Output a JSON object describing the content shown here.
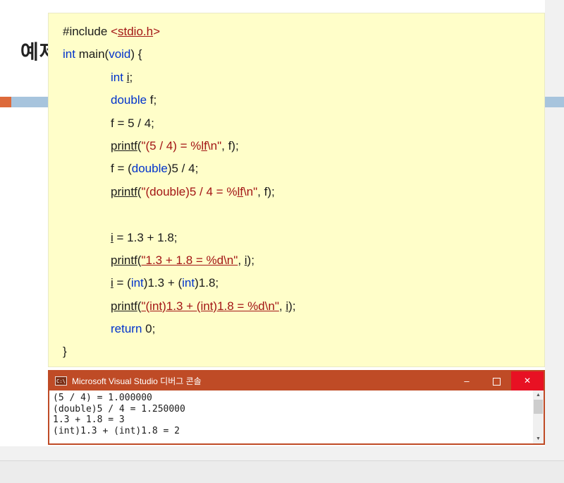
{
  "page": {
    "heading": "예제"
  },
  "colors": {
    "code_background": "#fffec9",
    "keyword_blue": "#0033cc",
    "string_maroon": "#a31515",
    "console_titlebar_orange": "#bf4b26",
    "close_button_red": "#e81123",
    "divider_blue": "#a7c4dd",
    "divider_orange": "#dd6a3b"
  },
  "code": {
    "lines": [
      {
        "ind": 0,
        "seg": [
          {
            "t": "#include ",
            "c": "p"
          },
          {
            "t": "<",
            "c": "s"
          },
          {
            "t": "stdio.h",
            "c": "s",
            "u": true
          },
          {
            "t": ">",
            "c": "s"
          }
        ]
      },
      {
        "ind": 0,
        "seg": [
          {
            "t": "int",
            "c": "k"
          },
          {
            "t": " main(",
            "c": "p"
          },
          {
            "t": "void",
            "c": "k"
          },
          {
            "t": ") {",
            "c": "p"
          }
        ]
      },
      {
        "ind": 1,
        "seg": [
          {
            "t": "int",
            "c": "k"
          },
          {
            "t": " ",
            "c": "p"
          },
          {
            "t": "i",
            "c": "p",
            "u": true
          },
          {
            "t": ";",
            "c": "p"
          }
        ]
      },
      {
        "ind": 1,
        "seg": [
          {
            "t": "double",
            "c": "k"
          },
          {
            "t": " f;",
            "c": "p"
          }
        ]
      },
      {
        "ind": 1,
        "seg": [
          {
            "t": "f = 5 / 4;",
            "c": "p"
          }
        ]
      },
      {
        "ind": 1,
        "seg": [
          {
            "t": "printf",
            "c": "p",
            "u": true
          },
          {
            "t": "(",
            "c": "p"
          },
          {
            "t": "\"(5 / 4) = %",
            "c": "s"
          },
          {
            "t": "lf",
            "c": "s",
            "u": true
          },
          {
            "t": "\\n\"",
            "c": "s"
          },
          {
            "t": ", f);",
            "c": "p"
          }
        ]
      },
      {
        "ind": 1,
        "seg": [
          {
            "t": "f = (",
            "c": "p"
          },
          {
            "t": "double",
            "c": "k"
          },
          {
            "t": ")5 / 4;",
            "c": "p"
          }
        ]
      },
      {
        "ind": 1,
        "seg": [
          {
            "t": "printf",
            "c": "p",
            "u": true
          },
          {
            "t": "(",
            "c": "p"
          },
          {
            "t": "\"(double)5 / 4 = %",
            "c": "s"
          },
          {
            "t": "lf",
            "c": "s",
            "u": true
          },
          {
            "t": "\\n\"",
            "c": "s"
          },
          {
            "t": ", f);",
            "c": "p"
          }
        ]
      },
      {
        "ind": 1,
        "seg": []
      },
      {
        "ind": 1,
        "seg": [
          {
            "t": "i",
            "c": "p",
            "u": true
          },
          {
            "t": " = 1.3 + 1.8;",
            "c": "p"
          }
        ]
      },
      {
        "ind": 1,
        "seg": [
          {
            "t": "printf",
            "c": "p",
            "u": true
          },
          {
            "t": "(",
            "c": "p"
          },
          {
            "t": "\"1.3 + 1.8 = %d\\n\"",
            "c": "s",
            "u": true
          },
          {
            "t": ", ",
            "c": "p"
          },
          {
            "t": "i",
            "c": "p",
            "u": true
          },
          {
            "t": ");",
            "c": "p"
          }
        ]
      },
      {
        "ind": 1,
        "seg": [
          {
            "t": "i",
            "c": "p",
            "u": true
          },
          {
            "t": " = (",
            "c": "p"
          },
          {
            "t": "int",
            "c": "k"
          },
          {
            "t": ")1.3 + (",
            "c": "p"
          },
          {
            "t": "int",
            "c": "k"
          },
          {
            "t": ")1.8;",
            "c": "p"
          }
        ]
      },
      {
        "ind": 1,
        "seg": [
          {
            "t": "printf",
            "c": "p",
            "u": true
          },
          {
            "t": "(",
            "c": "p"
          },
          {
            "t": "\"(int)1.3 + (int)1.8 = %d\\n\"",
            "c": "s",
            "u": true
          },
          {
            "t": ", ",
            "c": "p"
          },
          {
            "t": "i",
            "c": "p",
            "u": true
          },
          {
            "t": ");",
            "c": "p"
          }
        ]
      },
      {
        "ind": 1,
        "seg": [
          {
            "t": "return",
            "c": "k"
          },
          {
            "t": " 0;",
            "c": "p"
          }
        ]
      },
      {
        "ind": 0,
        "seg": [
          {
            "t": "}",
            "c": "p"
          }
        ]
      }
    ]
  },
  "console": {
    "title": "Microsoft Visual Studio 디버그 콘솔",
    "icon_label": "C:\\",
    "controls": {
      "minimize": "–",
      "close": "✕"
    },
    "scrollbar": {
      "up_glyph": "▲",
      "down_glyph": "▼"
    },
    "lines": [
      "(5 / 4) = 1.000000",
      "(double)5 / 4 = 1.250000",
      "1.3 + 1.8 = 3",
      "(int)1.3 + (int)1.8 = 2"
    ]
  }
}
